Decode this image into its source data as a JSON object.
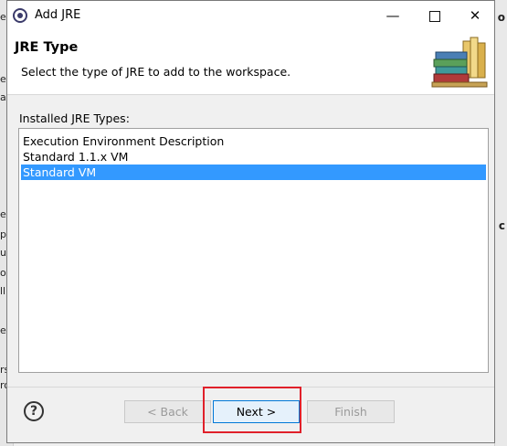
{
  "window": {
    "title": "Add JRE",
    "minimize_glyph": "—",
    "close_glyph": "✕"
  },
  "header": {
    "title": "JRE Type",
    "description": "Select the type of JRE to add to the workspace."
  },
  "list": {
    "label": "Installed JRE Types:",
    "items": [
      {
        "label": "Execution Environment Description",
        "selected": false
      },
      {
        "label": "Standard 1.1.x VM",
        "selected": false
      },
      {
        "label": "Standard VM",
        "selected": true
      }
    ]
  },
  "buttons": {
    "help": "?",
    "back": "< Back",
    "next": "Next >",
    "finish": "Finish"
  },
  "background": {
    "left_fragments": [
      "ex",
      "ec",
      "ar",
      "e",
      "p",
      "ug",
      "or",
      "ll",
      "e",
      "rs",
      "ro"
    ],
    "right_fragments": [
      "o",
      "c"
    ]
  },
  "colors": {
    "selection": "#3399ff",
    "highlight_box": "#e0202a",
    "default_button_border": "#0078d7"
  },
  "icons": {
    "title": "eclipse-icon",
    "header": "books-icon",
    "help": "help-icon"
  }
}
